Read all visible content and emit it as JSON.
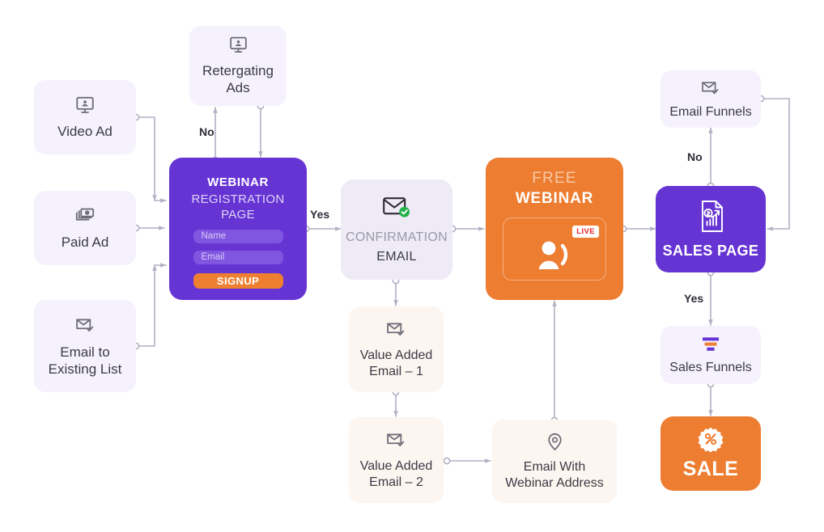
{
  "diagram": {
    "title": "Webinar Funnel Flowchart",
    "colors": {
      "purple": "#6734D4",
      "orange": "#ED7D31",
      "lavender": "#F5F2FD",
      "cream": "#FDF5EF",
      "confirm_bg": "#EEEAF6",
      "wire": "#b3afc4",
      "live_red": "#E8232A",
      "check_green": "#22B24C"
    },
    "nodes": [
      {
        "id": "video_ad",
        "label": "Video Ad",
        "icon": "monitor-person-icon"
      },
      {
        "id": "paid_ad",
        "label": "Paid Ad",
        "icon": "banknotes-icon"
      },
      {
        "id": "email_existing",
        "label": "Email to\nExisting List",
        "icon": "envelope-check-icon"
      },
      {
        "id": "retargeting",
        "label": "Retergating\nAds",
        "icon": "monitor-person-icon"
      },
      {
        "id": "registration",
        "title_line1": "WEBINAR",
        "title_line2": "REGISTRATION PAGE",
        "fields": [
          "Name",
          "Email"
        ],
        "button": "SIGNUP"
      },
      {
        "id": "confirmation",
        "line1": "CONFIRMATION",
        "line2": "EMAIL",
        "icon": "envelope-check-badge-icon"
      },
      {
        "id": "value_email_1",
        "label": "Value Added\nEmail – 1",
        "icon": "envelope-check-icon"
      },
      {
        "id": "value_email_2",
        "label": "Value Added\nEmail – 2",
        "icon": "envelope-check-icon"
      },
      {
        "id": "webinar_address",
        "label": "Email With\nWebinar Address",
        "icon": "map-pin-icon"
      },
      {
        "id": "free_webinar",
        "title_line1": "FREE",
        "title_line2": "WEBINAR",
        "badge": "LIVE",
        "icon": "presenter-icon"
      },
      {
        "id": "email_funnels",
        "label": "Email Funnels",
        "icon": "envelope-check-icon"
      },
      {
        "id": "sales_page",
        "label": "SALES PAGE",
        "icon": "sales-document-icon"
      },
      {
        "id": "sales_funnels",
        "label": "Sales Funnels",
        "icon": "funnel-icon"
      },
      {
        "id": "sale",
        "label": "SALE",
        "icon": "discount-badge-icon"
      }
    ],
    "edge_labels": {
      "no_retargeting": "No",
      "yes_confirmation": "Yes",
      "no_email_funnels": "No",
      "yes_sales_funnels": "Yes"
    }
  }
}
